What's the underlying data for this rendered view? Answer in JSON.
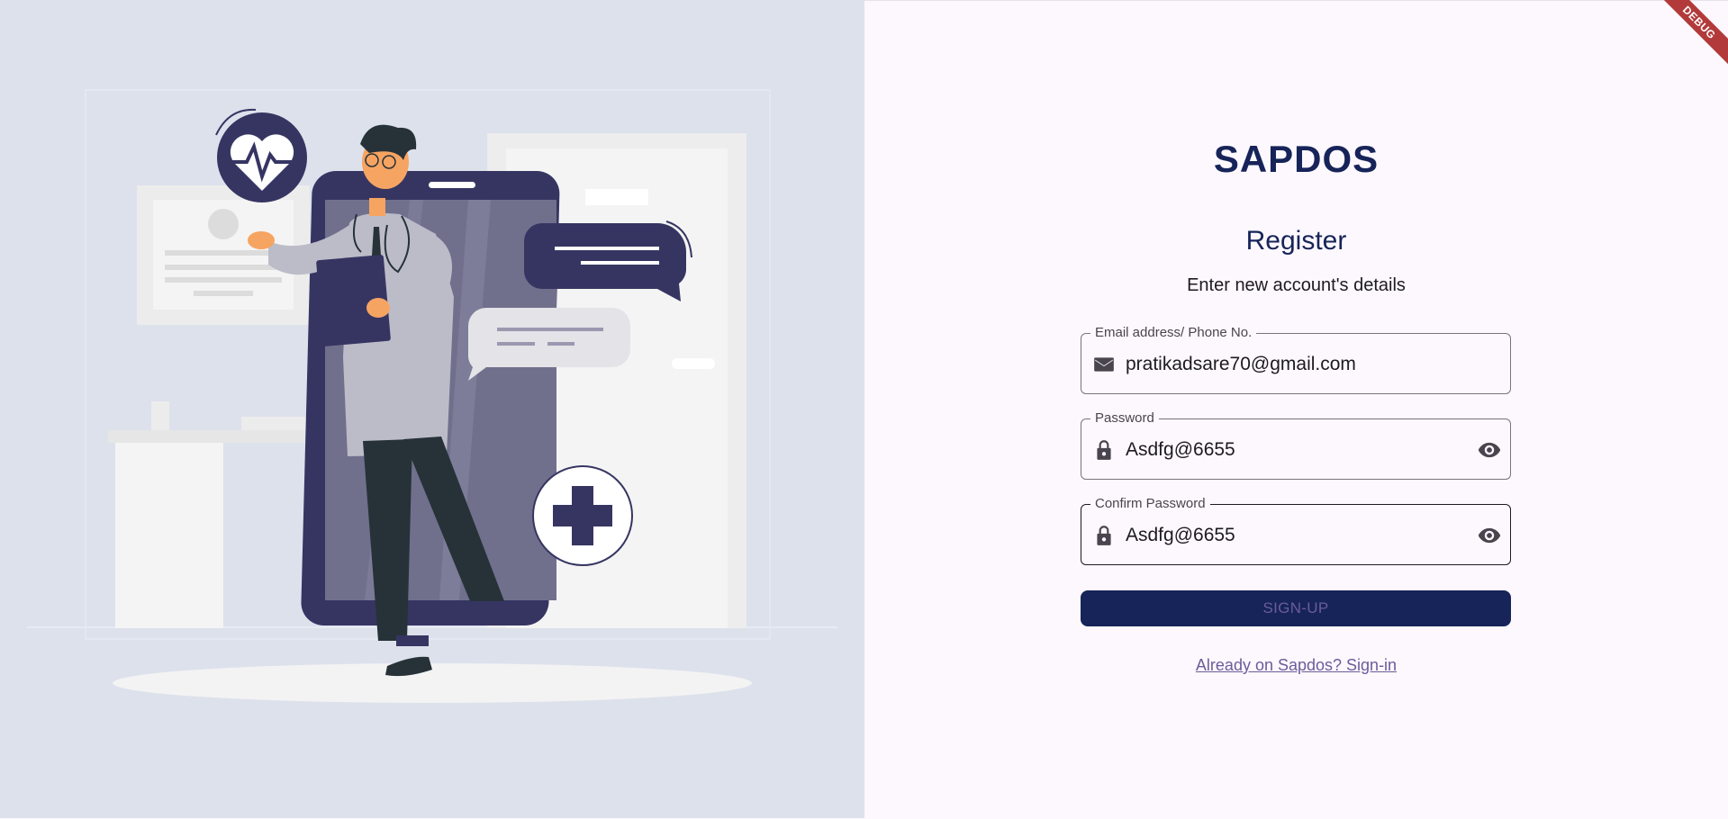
{
  "app": {
    "brand": "SAPDOS",
    "debug_badge": "DEBUG"
  },
  "form": {
    "title": "Register",
    "subtitle": "Enter new account's details",
    "email": {
      "label": "Email address/ Phone No.",
      "value": "pratikadsare70@gmail.com",
      "icon": "mail-icon"
    },
    "password": {
      "label": "Password",
      "value": "Asdfg@6655",
      "icon": "lock-icon",
      "toggle_icon": "eye-icon"
    },
    "confirm_password": {
      "label": "Confirm Password",
      "value": "Asdfg@6655",
      "icon": "lock-icon",
      "toggle_icon": "eye-icon"
    },
    "submit_label": "SIGN-UP",
    "signin_link": "Already on Sapdos? Sign-in"
  },
  "colors": {
    "brand": "#172459",
    "left_panel_bg": "#dde1ec",
    "right_panel_bg": "#fdf8fd",
    "button_text": "#6a5d9a",
    "illustration_accent": "#363562"
  }
}
